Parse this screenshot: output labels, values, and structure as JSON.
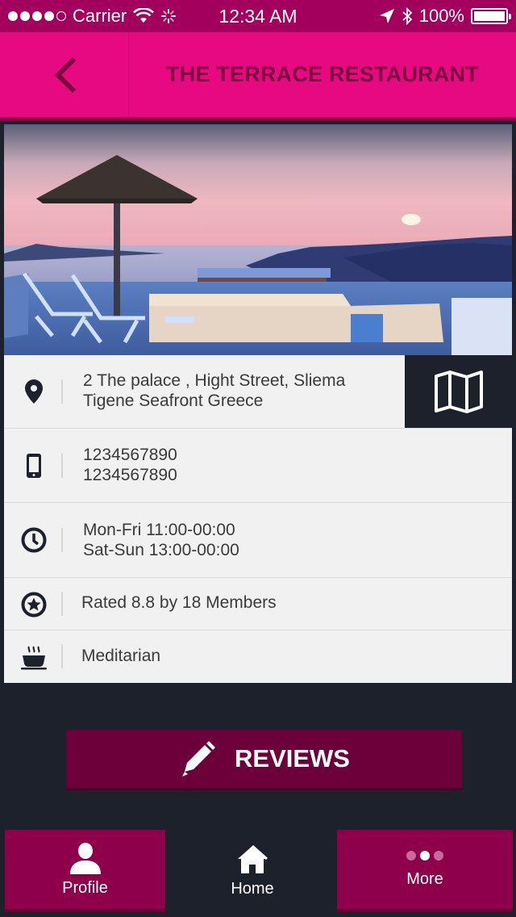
{
  "status_bar": {
    "carrier": "Carrier",
    "time": "12:34 AM",
    "battery": "100%"
  },
  "header": {
    "title": "THE TERRACE RESTAURANT"
  },
  "details": {
    "address_line1": "2 The palace , Hight Street, Sliema",
    "address_line2": "Tigene Seafront Greece",
    "phone_1": "1234567890",
    "phone_2": "1234567890",
    "hours_1": "Mon-Fri 11:00-00:00",
    "hours_2": "Sat-Sun 13:00-00:00",
    "rating": "Rated 8.8 by 18 Members",
    "cuisine": "Meditarian"
  },
  "reviews_button": "REVIEWS",
  "tabs": [
    {
      "label": "Profile",
      "icon": "user-icon"
    },
    {
      "label": "Home",
      "icon": "home-icon"
    },
    {
      "label": "More",
      "icon": "more-dots-icon"
    }
  ],
  "colors": {
    "accent_pink": "#e6097f",
    "dark_magenta": "#8e0049",
    "navy": "#1c212b"
  }
}
